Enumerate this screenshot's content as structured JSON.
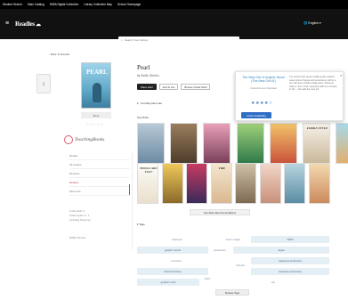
{
  "topbar": {
    "links": [
      "Student Search",
      "Main Catalog",
      "WWA Digital Collection",
      "Library Collection Map",
      "School Homepage"
    ]
  },
  "header": {
    "logo": "Readles",
    "search_placeholder": "Search Your Library",
    "language": "English"
  },
  "back_label": "Back To Results",
  "book": {
    "cover_title": "PEARL",
    "title": "Pearl",
    "byline": "by Smith, Sherri L.",
    "format": "Book",
    "rating_small": "☆☆☆☆☆",
    "buttons": {
      "place_hold": "Place Hold",
      "add_to_list": "Add To List",
      "browse_shelf": "Browse Virtual Shelf"
    }
  },
  "teachingbooks": {
    "label": "TeachingBooks"
  },
  "leftnav": {
    "items": [
      {
        "label": "Details"
      },
      {
        "label": "All Copies"
      },
      {
        "label": "Reviews"
      },
      {
        "label": "Related"
      },
      {
        "label": "More Info"
      }
    ],
    "meta_lines": [
      "Total Holds: 0",
      "Total Copies: 0 · 1",
      "Including Reserves"
    ],
    "meta2": "MARC Record"
  },
  "recommendations": {
    "you_may_also_like": "You May Also Like",
    "top_picks": "Top Picks",
    "see_more": "See More Recommendations",
    "covers": [
      {
        "label": "",
        "colors": [
          "#b7c9d6",
          "#6d8aa3"
        ]
      },
      {
        "label": "",
        "colors": [
          "#9a7f5e",
          "#4e3b2a"
        ]
      },
      {
        "label": "",
        "colors": [
          "#e8a0b8",
          "#7a3f5a"
        ]
      },
      {
        "label": "",
        "colors": [
          "#9fd07a",
          "#2f7a4a"
        ]
      },
      {
        "label": "",
        "colors": [
          "#f2c26a",
          "#c9533b"
        ]
      },
      {
        "label": "FAMILY STYLE",
        "colors": [
          "#f6f1e8",
          "#c9b89a"
        ]
      },
      {
        "label": "",
        "colors": [
          "#a8d8e8",
          "#e0b070"
        ]
      },
      {
        "label": "HUDA F ARE YOU?",
        "colors": [
          "#fdfcf7",
          "#e9dfcc"
        ]
      },
      {
        "label": "",
        "colors": [
          "#f0c85a",
          "#8a6a2a"
        ]
      },
      {
        "label": "",
        "colors": [
          "#c83a62",
          "#3a2a5a"
        ]
      },
      {
        "label": "FIRE",
        "colors": [
          "#f5e6d0",
          "#d8b890"
        ]
      },
      {
        "label": "",
        "colors": [
          "#cfc0a8",
          "#7d6a52"
        ]
      },
      {
        "label": "",
        "colors": [
          "#f2d6c8",
          "#c8907a"
        ]
      },
      {
        "label": "",
        "colors": [
          "#b8d5e0",
          "#5b8ca3"
        ]
      },
      {
        "label": "",
        "colors": [
          "#f3d9b1",
          "#cc8a5c"
        ]
      }
    ]
  },
  "popup": {
    "title": "The New Girl: A Graphic Novel (The New Girl #1)",
    "sub": "Cassandra Jean Illustrated",
    "stars": "★★★★☆",
    "button": "Check Availability",
    "description": "The stories that speak middle-grade readers sweet about change and acceptance will be a fan with fans of Raina Telgemeier, Shannon Hale or Jerry Craft. Jacquelyn Edmo is thirteen or the .. she said the new girl."
  },
  "tags": {
    "label": "Tags",
    "items": [
      "Japanese",
      "Just in Japan",
      "WWII",
      "graphic novels",
      "adolescent",
      "Japan",
      "American",
      "Friends",
      "Japanese Americans",
      "historical fiction",
      "Japanese-Americans",
      "graphic novel",
      "carlin",
      "ww"
    ],
    "browse": "Browse Tags"
  },
  "colors": {
    "accent": "#c74b5a",
    "link": "#2c7fb8",
    "primary_button": "#2f6ec6"
  }
}
